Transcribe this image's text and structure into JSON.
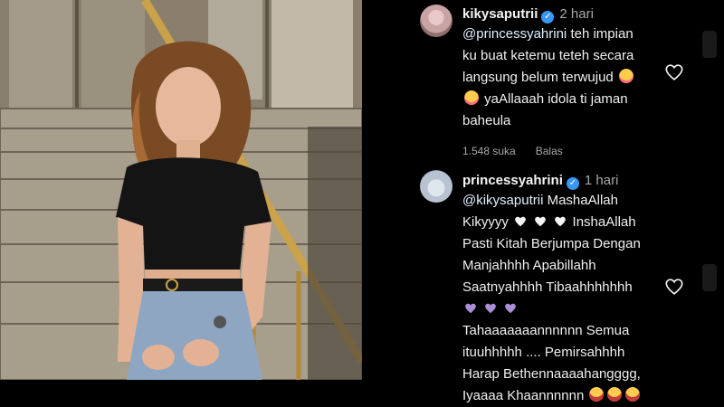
{
  "comments": [
    {
      "username": "kikysaputrii",
      "time": "2 hari",
      "text_line1_mention": "@princessyahrini",
      "text_line1_rest": " teh impian",
      "text_line2": "ku buat ketemu teteh secara",
      "text_line3": "langsung belum terwujud",
      "text_line4": " yaAllaaah idola ti jaman",
      "text_line5": "baheula",
      "likes": "1.548 suka",
      "reply_label": "Balas"
    },
    {
      "username": "princessyahrini",
      "time": "1 hari",
      "line1_mention": "@kikysaputrii",
      "line1_rest": " MashaAllah",
      "line2_a": "Kikyyyy ",
      "line2_b": " InshaAllah",
      "line3": "Pasti Kitah Berjumpa Dengan",
      "line4": "Manjahhhh Apabillahh",
      "line5": "Saatnyahhhh Tibaahhhhhhh",
      "line7": "Tahaaaaaaannnnnn Semua",
      "line8": "ituuhhhhh .... Pemirsahhhh",
      "line9": "Harap Bethennaaaahangggg,",
      "line10": "Iyaaaa Khaannnnnn"
    }
  ],
  "icons": {
    "verified": "verified-badge-icon",
    "heart": "heart-outline-icon",
    "cry": "crying-face-emoji",
    "white_heart": "white-heart-emoji",
    "purple_heart": "purple-heart-emoji",
    "grin": "grinning-face-emoji"
  },
  "colors": {
    "verified": "#3897f0",
    "meta": "#a8a8a8",
    "background": "#000000"
  }
}
